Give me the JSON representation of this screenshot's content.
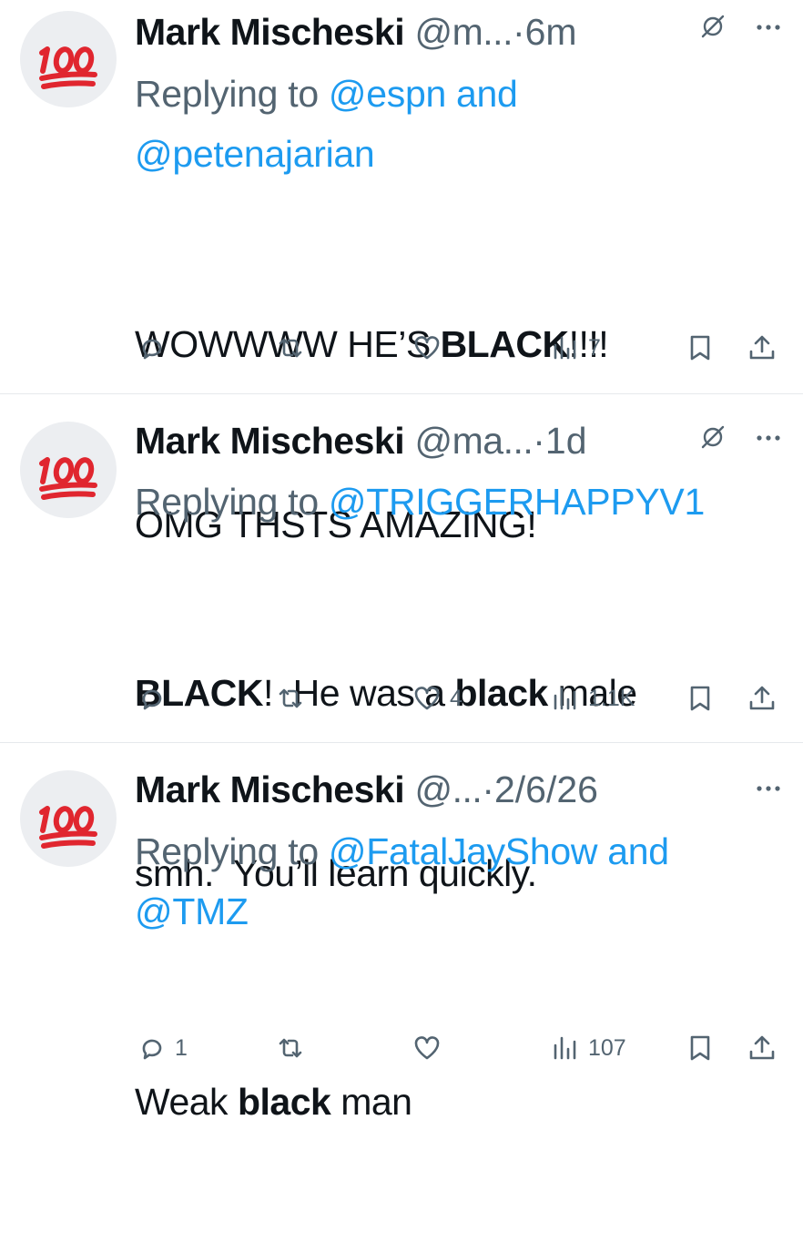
{
  "tweets": [
    {
      "avatar_emoji": "100",
      "name": "Mark Mischeski",
      "handle": "@m...",
      "sep": "·",
      "time": "6m",
      "reply_prefix": "Replying to ",
      "reply_line1_mention": "@espn",
      "reply_line1_suffix": " and",
      "reply_line2": "@petenajarian",
      "body_lines": [
        {
          "pre": "WOWWWW HE’S ",
          "bold": "BLACK",
          "post": "!!!!"
        },
        {
          "pre": "OMG THSTS AMAZING!",
          "bold": "",
          "post": ""
        }
      ],
      "stats": {
        "replies": "",
        "reposts": "",
        "likes": "",
        "views": "7"
      },
      "show_grok": true
    },
    {
      "avatar_emoji": "100",
      "name": "Mark Mischeski",
      "handle": "@ma...",
      "sep": "·",
      "time": "1d",
      "reply_prefix": "Replying to ",
      "reply_line1_mention": "@TRIGGERHAPPYV1",
      "reply_line1_suffix": "",
      "reply_line2": "",
      "body_lines": [
        {
          "pre": "",
          "bold": "BLACK",
          "post": "!  He was a "
        },
        {
          "pre": "smh.  You’ll learn quickly.",
          "bold": "",
          "post": ""
        }
      ],
      "body_line1_bold2": "black",
      "body_line1_tail": " male",
      "stats": {
        "replies": "",
        "reposts": "",
        "likes": "4",
        "views": "1.1K"
      },
      "show_grok": true
    },
    {
      "avatar_emoji": "100",
      "name": "Mark Mischeski",
      "handle": "@...",
      "sep": "·",
      "time": "2/6/26",
      "reply_prefix": "Replying to ",
      "reply_line1_mention": "@FatalJayShow",
      "reply_line1_suffix": " and",
      "reply_line2": "@TMZ",
      "body_lines": [
        {
          "pre": "Weak ",
          "bold": "black",
          "post": " man"
        }
      ],
      "stats": {
        "replies": "1",
        "reposts": "",
        "likes": "",
        "views": "107"
      },
      "show_grok": false
    }
  ],
  "colors": {
    "text": "#0f1419",
    "secondary": "#536471",
    "link": "#1d9bf0",
    "emoji_red": "#e0262f",
    "divider": "#e6e9ec"
  },
  "icons": [
    "reply-icon",
    "repost-icon",
    "like-icon",
    "views-icon",
    "bookmark-icon",
    "share-icon",
    "grok-icon",
    "more-icon",
    "hundred-points-emoji"
  ]
}
